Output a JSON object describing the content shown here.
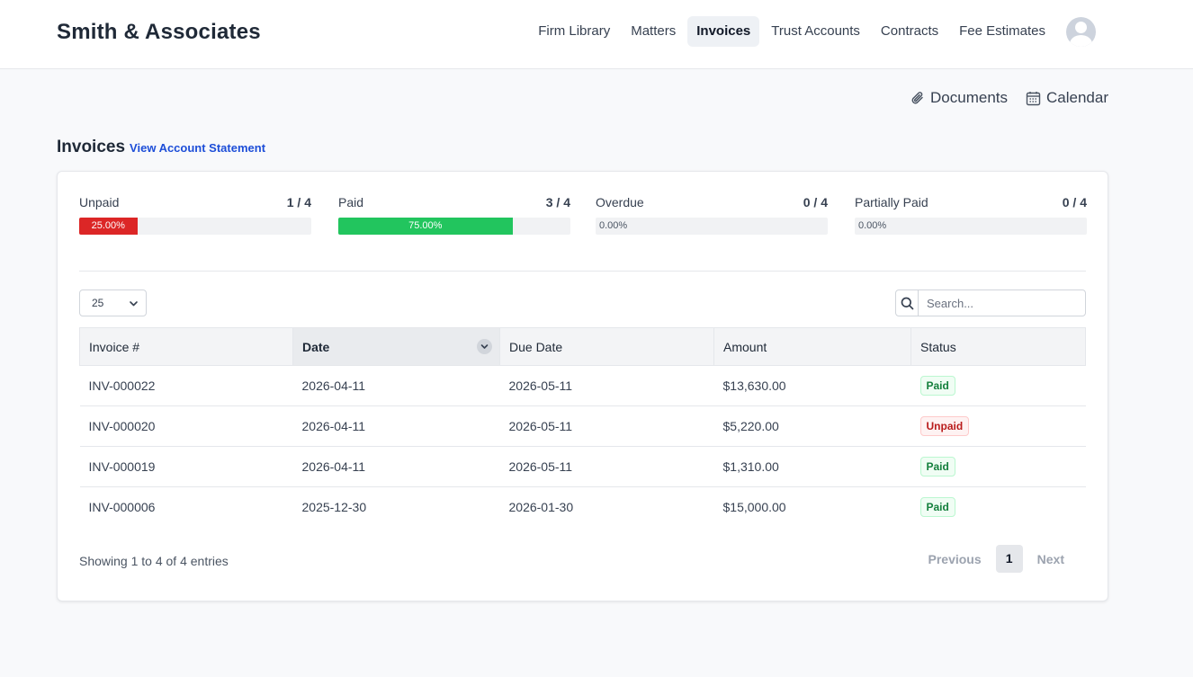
{
  "brand": "Smith & Associates",
  "nav": [
    {
      "label": "Firm Library"
    },
    {
      "label": "Matters"
    },
    {
      "label": "Invoices",
      "active": true
    },
    {
      "label": "Trust Accounts"
    },
    {
      "label": "Contracts"
    },
    {
      "label": "Fee Estimates"
    }
  ],
  "quicklinks": {
    "documents": "Documents",
    "calendar": "Calendar"
  },
  "page": {
    "title": "Invoices",
    "statement_link": "View Account Statement"
  },
  "stats": [
    {
      "label": "Unpaid",
      "count": "1 / 4",
      "percent": 25.0,
      "percent_text": "25.00%",
      "color": "#dc2626"
    },
    {
      "label": "Paid",
      "count": "3 / 4",
      "percent": 75.0,
      "percent_text": "75.00%",
      "color": "#22c55e"
    },
    {
      "label": "Overdue",
      "count": "0 / 4",
      "percent": 0,
      "percent_text": "0.00%",
      "color": "#f59e0b"
    },
    {
      "label": "Partially Paid",
      "count": "0 / 4",
      "percent": 0,
      "percent_text": "0.00%",
      "color": "#3b82f6"
    }
  ],
  "controls": {
    "page_length": "25",
    "search_placeholder": "Search..."
  },
  "table": {
    "columns": [
      "Invoice #",
      "Date",
      "Due Date",
      "Amount",
      "Status"
    ],
    "rows": [
      {
        "invoice": "INV-000022",
        "date": "2026-04-11",
        "due": "2026-05-11",
        "amount": "$13,630.00",
        "status": "Paid"
      },
      {
        "invoice": "INV-000020",
        "date": "2026-04-11",
        "due": "2026-05-11",
        "amount": "$5,220.00",
        "status": "Unpaid"
      },
      {
        "invoice": "INV-000019",
        "date": "2026-04-11",
        "due": "2026-05-11",
        "amount": "$1,310.00",
        "status": "Paid"
      },
      {
        "invoice": "INV-000006",
        "date": "2025-12-30",
        "due": "2026-01-30",
        "amount": "$15,000.00",
        "status": "Paid"
      }
    ]
  },
  "footer": {
    "info": "Showing 1 to 4 of 4 entries",
    "previous": "Previous",
    "current_page": "1",
    "next": "Next"
  }
}
